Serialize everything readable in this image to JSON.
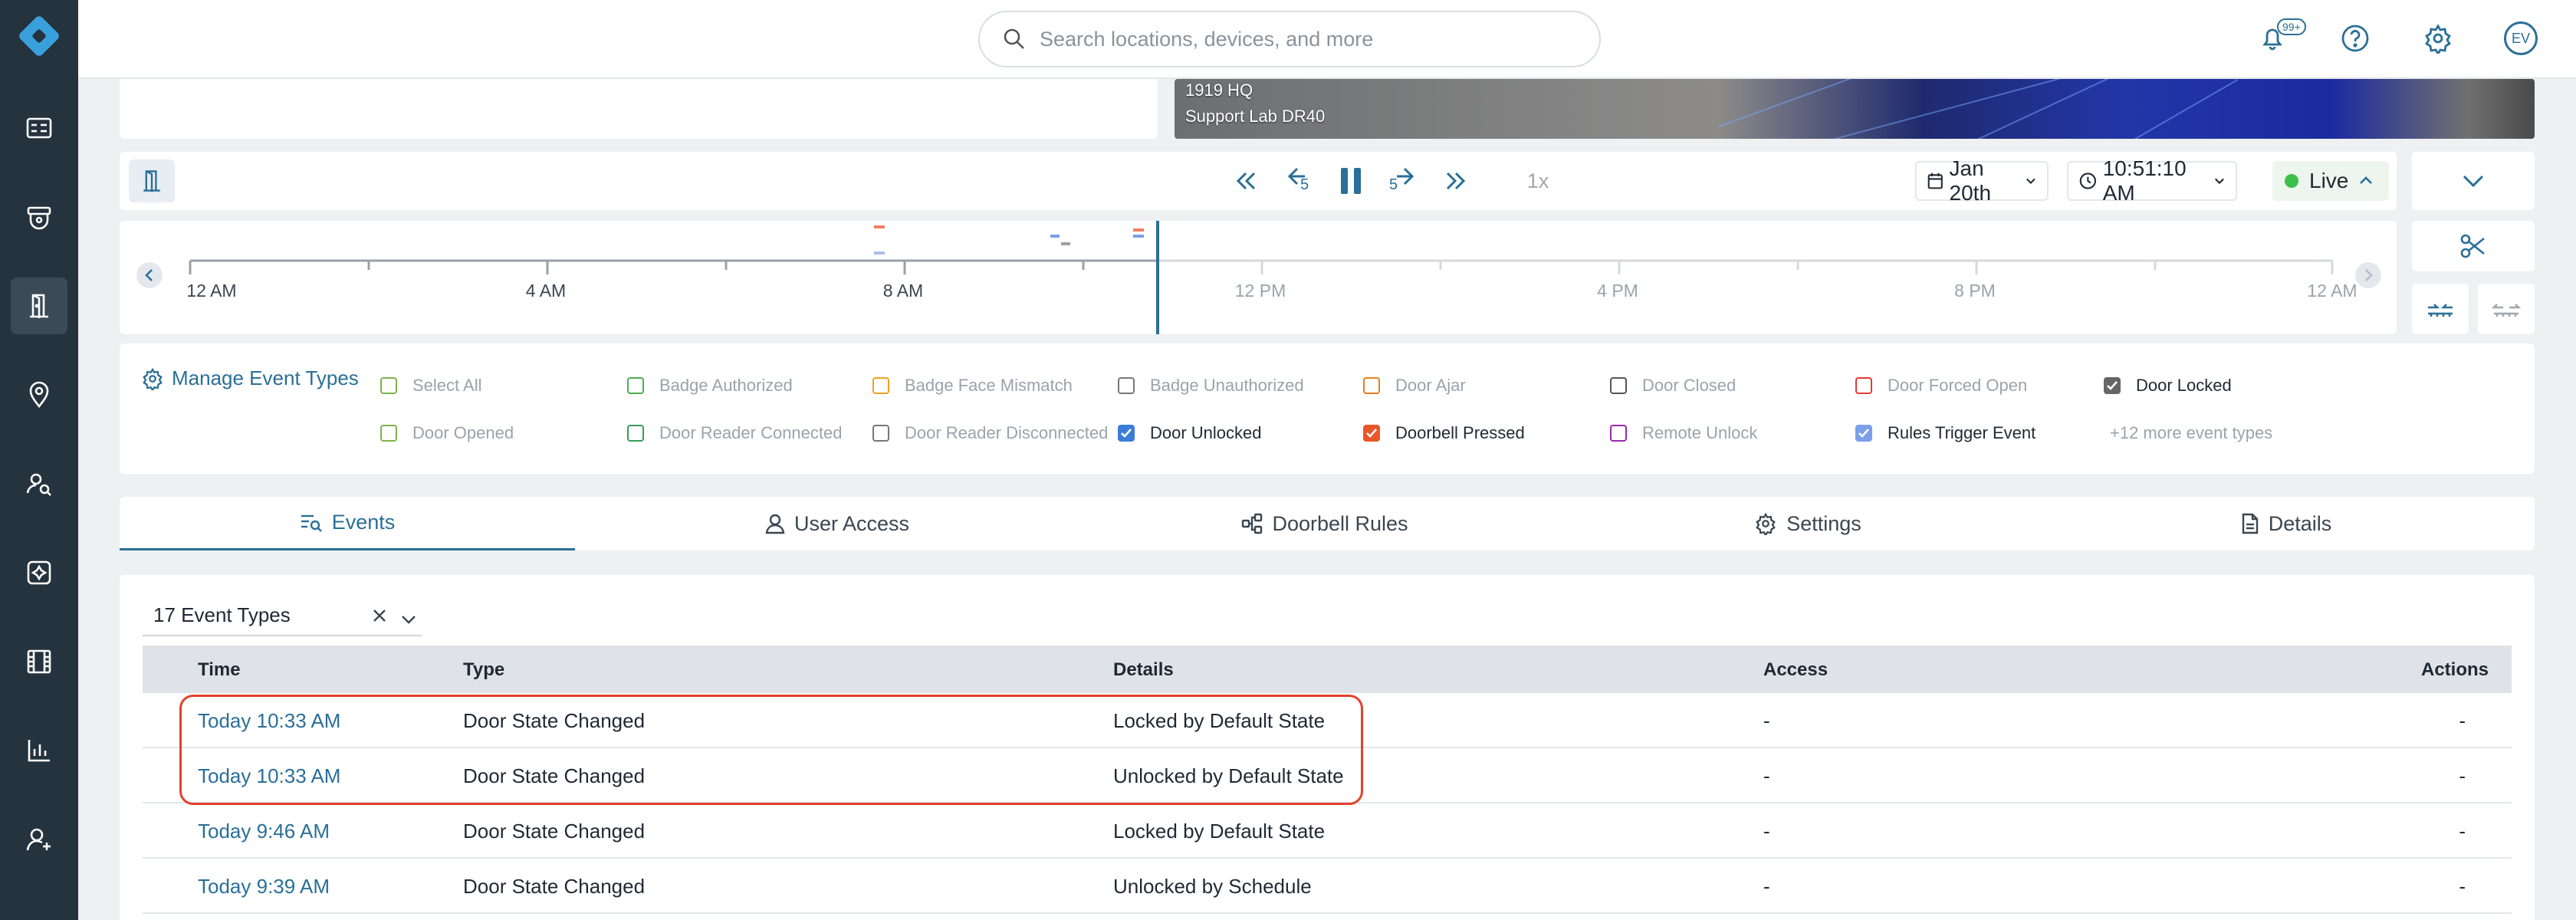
{
  "nav": {
    "items": [
      "dashboard-icon",
      "camera-icon",
      "door-icon",
      "location-icon",
      "search-person-icon",
      "add-widget-icon",
      "film-icon",
      "chart-icon",
      "add-user-icon"
    ]
  },
  "topbar": {
    "search_placeholder": "Search locations, devices, and more",
    "notification_badge": "99+",
    "avatar_initials": "EV"
  },
  "camera": {
    "line1": "1919 HQ",
    "line2": "Support Lab DR40"
  },
  "controls": {
    "speed": "1x",
    "date": "Jan 20th",
    "time": "10:51:10 AM",
    "live": "Live",
    "skip_back_label": "5",
    "skip_fwd_label": "5"
  },
  "timeline": {
    "ticks": [
      "12 AM",
      "4 AM",
      "8 AM",
      "12 PM",
      "4 PM",
      "8 PM",
      "12 AM"
    ]
  },
  "event_types": {
    "manage_label": "Manage Event Types",
    "items": [
      {
        "label": "Select All",
        "checked": false,
        "color": "#7fb24a"
      },
      {
        "label": "Badge Authorized",
        "checked": false,
        "color": "#4caf50"
      },
      {
        "label": "Badge Face Mismatch",
        "checked": false,
        "color": "#f0a020"
      },
      {
        "label": "Badge Unauthorized",
        "checked": false,
        "color": "#777777"
      },
      {
        "label": "Door Ajar",
        "checked": false,
        "color": "#e67e22"
      },
      {
        "label": "Door Closed",
        "checked": false,
        "color": "#555555"
      },
      {
        "label": "Door Forced Open",
        "checked": false,
        "color": "#e53935"
      },
      {
        "label": "Door Locked",
        "checked": true,
        "color": "#666666"
      },
      {
        "label": "Door Opened",
        "checked": false,
        "color": "#7fb24a"
      },
      {
        "label": "Door Reader Connected",
        "checked": false,
        "color": "#3a9a5a"
      },
      {
        "label": "Door Reader Disconnected",
        "checked": false,
        "color": "#777777"
      },
      {
        "label": "Door Unlocked",
        "checked": true,
        "color": "#3b7dd8"
      },
      {
        "label": "Doorbell Pressed",
        "checked": true,
        "color": "#e8572a"
      },
      {
        "label": "Remote Unlock",
        "checked": false,
        "color": "#9c27b0"
      },
      {
        "label": "Rules Trigger Event",
        "checked": true,
        "color": "#7b9fe8"
      }
    ],
    "more_label": "+12 more event types"
  },
  "tabs": [
    {
      "label": "Events",
      "active": true
    },
    {
      "label": "User Access",
      "active": false
    },
    {
      "label": "Doorbell Rules",
      "active": false
    },
    {
      "label": "Settings",
      "active": false
    },
    {
      "label": "Details",
      "active": false
    }
  ],
  "events": {
    "filter_value": "17 Event Types",
    "columns": [
      "Time",
      "Type",
      "Details",
      "Access",
      "Actions"
    ],
    "rows": [
      {
        "time": "Today 10:33 AM",
        "type": "Door State Changed",
        "details": "Locked by Default State",
        "access": "-",
        "actions": "-"
      },
      {
        "time": "Today 10:33 AM",
        "type": "Door State Changed",
        "details": "Unlocked by Default State",
        "access": "-",
        "actions": "-"
      },
      {
        "time": "Today 9:46 AM",
        "type": "Door State Changed",
        "details": "Locked by Default State",
        "access": "-",
        "actions": "-"
      },
      {
        "time": "Today 9:39 AM",
        "type": "Door State Changed",
        "details": "Unlocked by Schedule",
        "access": "-",
        "actions": "-"
      }
    ]
  }
}
